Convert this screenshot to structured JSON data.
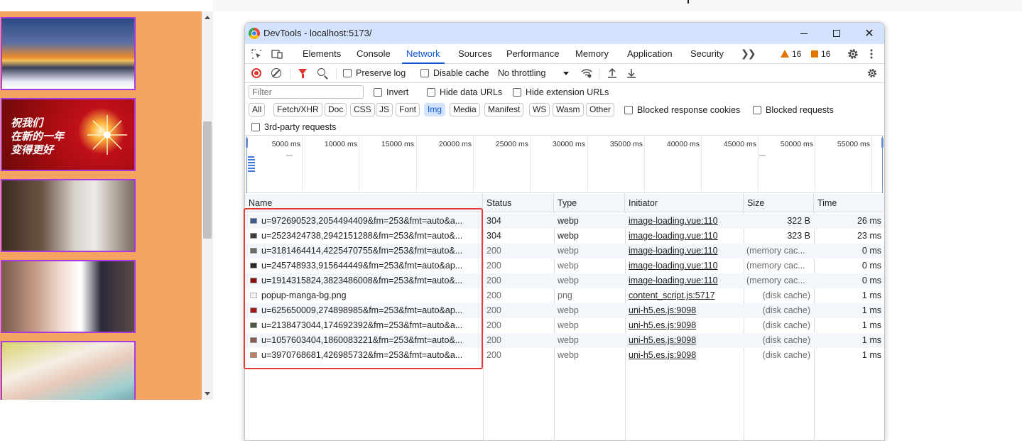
{
  "devtools": {
    "title": "DevTools - localhost:5173/",
    "tabs": [
      "Elements",
      "Console",
      "Network",
      "Sources",
      "Performance",
      "Memory",
      "Application",
      "Security"
    ],
    "active_tab": "Network",
    "warnings_count": "16",
    "issues_count": "16"
  },
  "network_toolbar": {
    "preserve_log": "Preserve log",
    "disable_cache": "Disable cache",
    "throttling": "No throttling"
  },
  "filter_bar": {
    "placeholder": "Filter",
    "invert": "Invert",
    "hide_data_urls": "Hide data URLs",
    "hide_extension_urls": "Hide extension URLs",
    "types": [
      "All",
      "Fetch/XHR",
      "Doc",
      "CSS",
      "JS",
      "Font",
      "Img",
      "Media",
      "Manifest",
      "WS",
      "Wasm",
      "Other"
    ],
    "active_type": "Img",
    "blocked_cookies": "Blocked response cookies",
    "blocked_requests": "Blocked requests",
    "third_party": "3rd-party requests"
  },
  "overview": {
    "ticks": [
      "5000 ms",
      "10000 ms",
      "15000 ms",
      "20000 ms",
      "25000 ms",
      "30000 ms",
      "35000 ms",
      "40000 ms",
      "45000 ms",
      "50000 ms",
      "55000 ms"
    ]
  },
  "table": {
    "headers": [
      "Name",
      "Status",
      "Type",
      "Initiator",
      "Size",
      "Time"
    ],
    "rows": [
      {
        "name": "u=972690523,2054494409&fm=253&fmt=auto&a...",
        "status": "304",
        "type": "webp",
        "initiator": "image-loading.vue:110",
        "size": "322 B",
        "time": "26 ms",
        "icon": "#3d5c8c"
      },
      {
        "name": "u=2523424738,2942151288&fm=253&fmt=auto&...",
        "status": "304",
        "type": "webp",
        "initiator": "image-loading.vue:110",
        "size": "323 B",
        "time": "23 ms",
        "icon": "#40403a"
      },
      {
        "name": "u=3181464414,4225470755&fm=253&fmt=auto&...",
        "status": "200",
        "type": "webp",
        "initiator": "image-loading.vue:110",
        "size": "(memory cac...",
        "time": "0 ms",
        "icon": "#6a6a6a"
      },
      {
        "name": "u=245748933,915644449&fm=253&fmt=auto&ap...",
        "status": "200",
        "type": "webp",
        "initiator": "image-loading.vue:110",
        "size": "(memory cac...",
        "time": "0 ms",
        "icon": "#2a2a2a"
      },
      {
        "name": "u=1914315824,3823486008&fm=253&fmt=auto&...",
        "status": "200",
        "type": "webp",
        "initiator": "image-loading.vue:110",
        "size": "(memory cac...",
        "time": "0 ms",
        "icon": "#8c1010"
      },
      {
        "name": "popup-manga-bg.png",
        "status": "200",
        "type": "png",
        "initiator": "content_script.js:5717",
        "size": "(disk cache)",
        "time": "1 ms",
        "icon": "png"
      },
      {
        "name": "u=625650009,274898985&fm=253&fmt=auto&ap...",
        "status": "200",
        "type": "webp",
        "initiator": "uni-h5.es.js:9098",
        "size": "(disk cache)",
        "time": "1 ms",
        "icon": "#a01818"
      },
      {
        "name": "u=2138473044,174692392&fm=253&fmt=auto&a...",
        "status": "200",
        "type": "webp",
        "initiator": "uni-h5.es.js:9098",
        "size": "(disk cache)",
        "time": "1 ms",
        "icon": "#4a5a40"
      },
      {
        "name": "u=1057603404,1860083221&fm=253&fmt=auto&...",
        "status": "200",
        "type": "webp",
        "initiator": "uni-h5.es.js:9098",
        "size": "(disk cache)",
        "time": "1 ms",
        "icon": "#8a5a4a"
      },
      {
        "name": "u=3970768681,426985732&fm=253&fmt=auto&a...",
        "status": "200",
        "type": "webp",
        "initiator": "uni-h5.es.js:9098",
        "size": "(disk cache)",
        "time": "1 ms",
        "icon": "#c08060"
      }
    ]
  },
  "page": {
    "banner_text": "祝我们\n在新的一年\n变得更好"
  }
}
